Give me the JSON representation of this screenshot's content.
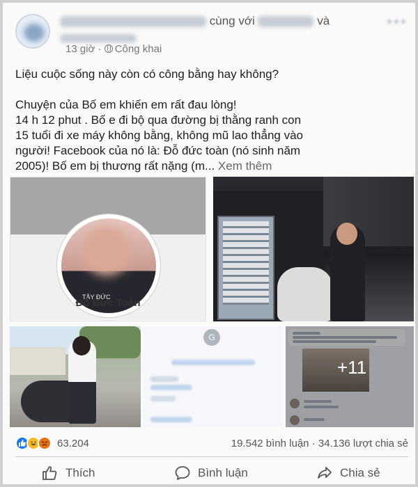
{
  "header": {
    "name_suffix": "cùng với",
    "and_text": "và",
    "time": "13 giờ",
    "separator": "·",
    "privacy": "Công khai"
  },
  "post": {
    "line1": "Liệu cuộc sống này còn có công bằng hay không?",
    "line2": "Chuyện của Bố em khiến em rất đau lòng!",
    "line3": "14 h 12 phut . Bố e đi bộ qua đường bị thằng ranh con",
    "line4": "15 tuổi đi xe máy không bằng, không mũ lao thẳng vào",
    "line5": "người! Facebook của nó là: Đỗ đức toàn (nó sinh năm",
    "line6": "2005)! Bố em bị thương rất nặng (m...",
    "see_more": "Xem thêm"
  },
  "gallery": {
    "profile_name": "Đỗ Đức Toàn",
    "shirt_text": "TÂY ĐỨC",
    "screenshot_avatar_letter": "G",
    "extra_count": "+11"
  },
  "stats": {
    "reactions": "63.204",
    "comments": "19.542 bình luận",
    "dot": "·",
    "shares": "34.136 lượt chia sẻ"
  },
  "actions": {
    "like": "Thích",
    "comment": "Bình luận",
    "share": "Chia sẻ"
  },
  "colors": {
    "like_blue": "#1877f2",
    "haha_yellow": "#f7b928",
    "angry_orange": "#e9710f"
  },
  "icons": [
    "globe-icon",
    "more-icon",
    "like-reaction-icon",
    "haha-reaction-icon",
    "angry-reaction-icon",
    "thumbs-up-icon",
    "comment-icon",
    "share-icon"
  ]
}
